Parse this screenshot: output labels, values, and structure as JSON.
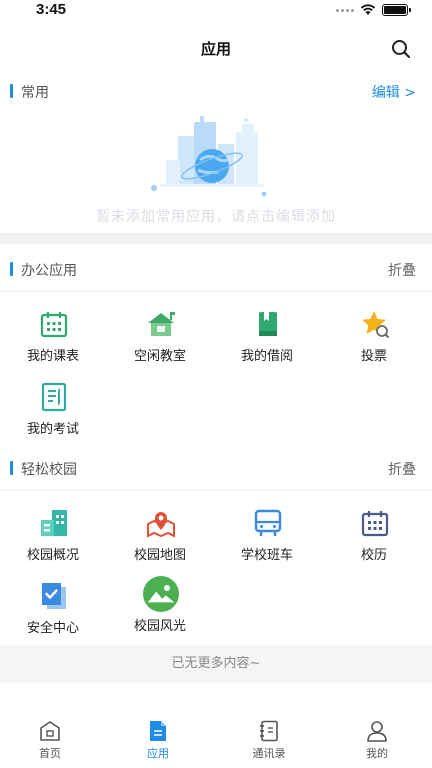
{
  "status_bar": {
    "time": "3:45"
  },
  "header": {
    "title": "应用",
    "search_icon": "search-icon"
  },
  "favorites": {
    "title": "常用",
    "action": "编辑 >",
    "empty_text": "暂未添加常用应用，请点击编辑添加",
    "illustration": "city-globe-illustration"
  },
  "office": {
    "title": "办公应用",
    "action": "折叠",
    "items": [
      {
        "label": "我的课表",
        "icon": "calendar-icon",
        "color": "#2eaa6e"
      },
      {
        "label": "空闲教室",
        "icon": "classroom-icon",
        "color": "#3faa66"
      },
      {
        "label": "我的借阅",
        "icon": "book-icon",
        "color": "#2eaa6e"
      },
      {
        "label": "投票",
        "icon": "vote-star-icon",
        "color": "#f5b21c"
      },
      {
        "label": "我的考试",
        "icon": "exam-icon",
        "color": "#2eaa9e"
      }
    ]
  },
  "campus": {
    "title": "轻松校园",
    "action": "折叠",
    "items": [
      {
        "label": "校园概况",
        "icon": "buildings-icon",
        "color": "#33b8a8"
      },
      {
        "label": "校园地图",
        "icon": "map-pin-icon",
        "color": "#e0513a"
      },
      {
        "label": "学校班车",
        "icon": "bus-icon",
        "color": "#3a8be0"
      },
      {
        "label": "校历",
        "icon": "calendar-icon",
        "color": "#4a5a8a"
      },
      {
        "label": "安全中心",
        "icon": "safety-check-icon",
        "color": "#3a8be0"
      },
      {
        "label": "校园风光",
        "icon": "landscape-icon",
        "color": "#4caf50"
      }
    ]
  },
  "no_more_text": "已无更多内容~",
  "tabs": [
    {
      "label": "首页",
      "icon": "home-icon",
      "active": false
    },
    {
      "label": "应用",
      "icon": "apps-doc-icon",
      "active": true
    },
    {
      "label": "通讯录",
      "icon": "contacts-icon",
      "active": false
    },
    {
      "label": "我的",
      "icon": "profile-icon",
      "active": false
    }
  ],
  "colors": {
    "accent": "#1f8ce6",
    "background": "#ffffff",
    "band": "#f2f2f2"
  }
}
